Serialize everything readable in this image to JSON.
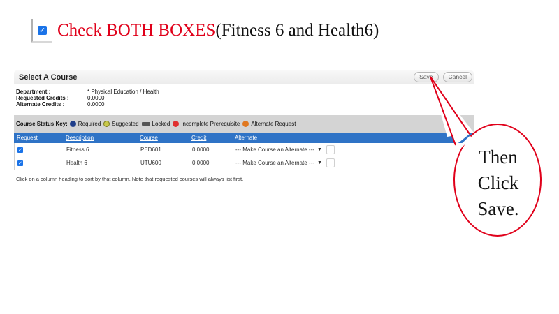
{
  "slide": {
    "title_red": "Check  BOTH BOXES",
    "title_black": "(Fitness   6  and  Health6)",
    "callout_lines": [
      "Then",
      "Click",
      "Save."
    ]
  },
  "panel": {
    "title": "Select A Course",
    "save_label": "Save",
    "cancel_label": "Cancel",
    "info": [
      {
        "label": "Department :",
        "value": "* Physical Education / Health"
      },
      {
        "label": "Requested Credits :",
        "value": "0.0000"
      },
      {
        "label": "Alternate Credits :",
        "value": "0.0000"
      }
    ],
    "status_key": {
      "label": "Course Status Key:",
      "required": "Required",
      "suggested": "Suggested",
      "locked": "Locked",
      "incomplete": "Incomplete Prerequisite",
      "alternate": "Alternate Request"
    },
    "columns": [
      "Request",
      "Description",
      "Course",
      "Credit",
      "Alternate"
    ],
    "rows": [
      {
        "description": "Fitness 6",
        "course": "PED601",
        "credit": "0.0000",
        "alternate": "--- Make Course an Alternate ---",
        "checked": true
      },
      {
        "description": "Health 6",
        "course": "UTU600",
        "credit": "0.0000",
        "alternate": "--- Make Course an Alternate ---",
        "checked": true
      }
    ],
    "note": "Click on a column heading to sort by that column. Note that requested courses will always list first."
  },
  "colors": {
    "accent_red": "#e0001a",
    "table_header_blue": "#2f73c6",
    "checkbox_blue": "#1a73e8"
  },
  "icons": [
    "checkbox-checked-icon",
    "required-icon",
    "suggested-icon",
    "locked-icon",
    "incomplete-prerequisite-icon",
    "alternate-request-icon",
    "chevron-down-icon"
  ]
}
